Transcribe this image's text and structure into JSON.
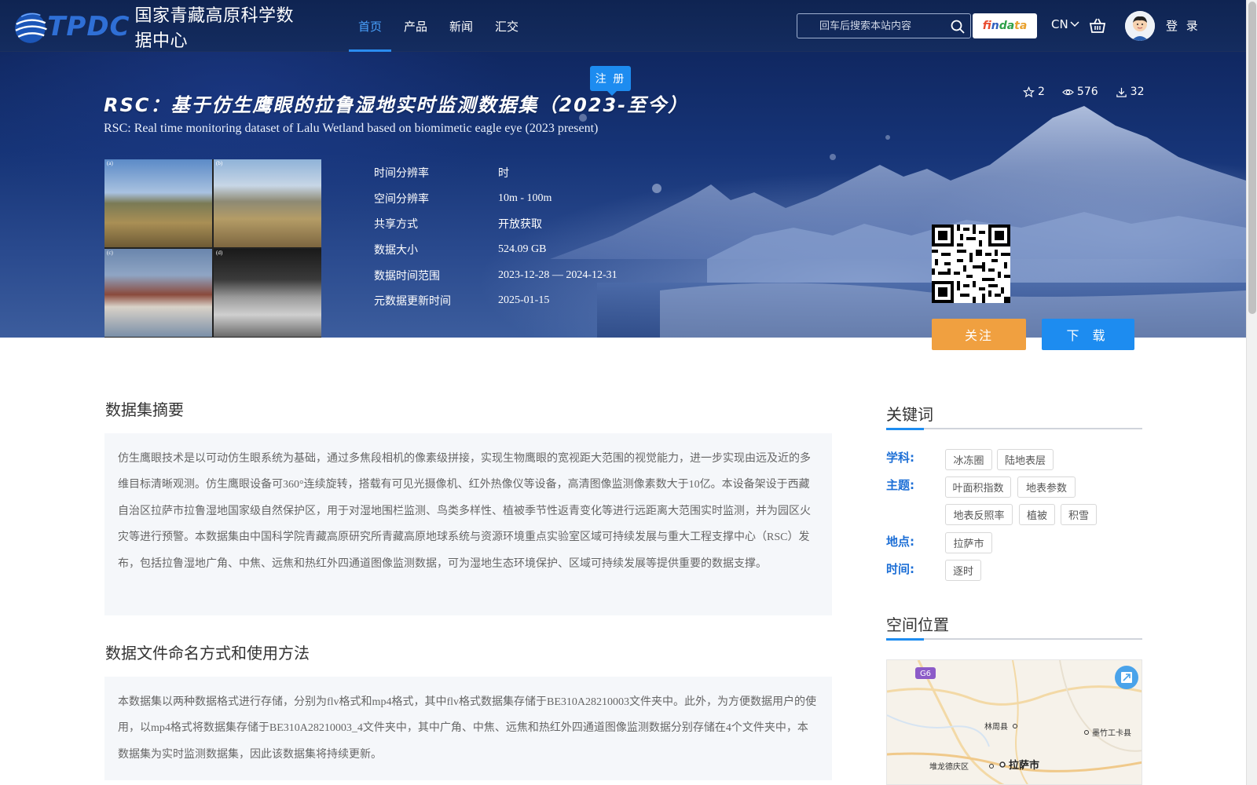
{
  "header": {
    "logo_text": "TPDC",
    "site_name": "国家青藏高原科学数据中心",
    "nav": [
      {
        "label": "首页",
        "active": true
      },
      {
        "label": "产品",
        "active": false
      },
      {
        "label": "新闻",
        "active": false
      },
      {
        "label": "汇交",
        "active": false
      }
    ],
    "search_placeholder": "回车后搜索本站内容",
    "findata": {
      "p1": "fi",
      "p2": "n",
      "p3": "da",
      "p4": "ta"
    },
    "lang": "CN",
    "login": "登 录",
    "register_tag": "注 册"
  },
  "dataset": {
    "title_cn": "RSC：基于仿生鹰眼的拉鲁湿地实时监测数据集（2023-至今）",
    "title_en": "RSC: Real time monitoring dataset of Lalu Wetland based on biomimetic eagle eye (2023 present)",
    "stats": {
      "favorites": "2",
      "views": "576",
      "downloads": "32"
    },
    "thumb_labels": [
      "(a)",
      "(b)",
      "(c)",
      "(d)"
    ],
    "meta": [
      {
        "label": "时间分辨率",
        "value": "时"
      },
      {
        "label": "空间分辨率",
        "value": "10m - 100m"
      },
      {
        "label": "共享方式",
        "value": "开放获取"
      },
      {
        "label": "数据大小",
        "value": "524.09 GB"
      },
      {
        "label": "数据时间范围",
        "value": "2023-12-28 — 2024-12-31"
      },
      {
        "label": "元数据更新时间",
        "value": "2025-01-15"
      }
    ],
    "btn_follow": "关注",
    "btn_download": "下 载"
  },
  "abstract": {
    "title": "数据集摘要",
    "text": "仿生鹰眼技术是以可动仿生眼系统为基础，通过多焦段相机的像素级拼接，实现生物鹰眼的宽视距大范围的视觉能力，进一步实现由远及近的多维目标清晰观测。仿生鹰眼设备可360°连续旋转，搭载有可见光摄像机、红外热像仪等设备，高清图像监测像素数大于10亿。本设备架设于西藏自治区拉萨市拉鲁湿地国家级自然保护区，用于对湿地围栏监测、鸟类多样性、植被季节性返青变化等进行远距离大范围实时监测，并为园区火灾等进行预警。本数据集由中国科学院青藏高原研究所青藏高原地球系统与资源环境重点实验室区域可持续发展与重大工程支撑中心（RSC）发布，包括拉鲁湿地广角、中焦、远焦和热红外四通道图像监测数据，可为湿地生态环境保护、区域可持续发展等提供重要的数据支撑。"
  },
  "naming": {
    "title": "数据文件命名方式和使用方法",
    "text": "本数据集以两种数据格式进行存储，分别为flv格式和mp4格式，其中flv格式数据集存储于BE310A28210003文件夹中。此外，为方便数据用户的使用，以mp4格式将数据集存储于BE310A28210003_4文件夹中，其中广角、中焦、远焦和热红外四通道图像监测数据分别存储在4个文件夹中，本数据集为实时监测数据集，因此该数据集将持续更新。"
  },
  "keywords": {
    "title": "关键词",
    "discipline_label": "学科:",
    "discipline": [
      "冰冻圈",
      "陆地表层"
    ],
    "theme_label": "主题:",
    "theme": [
      "叶面积指数",
      "地表参数",
      "地表反照率",
      "植被",
      "积雪"
    ],
    "place_label": "地点:",
    "place": [
      "拉萨市"
    ],
    "time_label": "时间:",
    "time": [
      "逐时"
    ]
  },
  "spatial": {
    "title": "空间位置",
    "map_labels": {
      "road": "G6",
      "linzhou": "林周县",
      "mozhugongka": "墨竹工卡县",
      "duilongdeqing": "堆龙德庆区",
      "lhasa": "拉萨市"
    }
  },
  "colors": {
    "accent": "#1d8cf0",
    "follow": "#f0a040",
    "keyword_label": "#1d6fd6"
  }
}
